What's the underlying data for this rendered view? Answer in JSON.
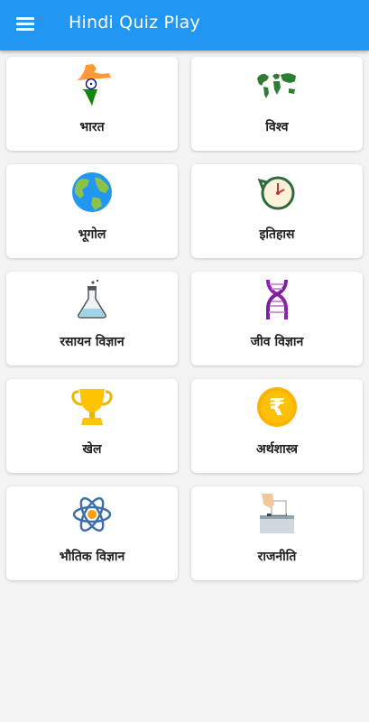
{
  "appbar": {
    "title": "Hindi Quiz Play",
    "menu_icon": "hamburger-menu-icon",
    "color": "#2196f3"
  },
  "categories": [
    {
      "label": "भारत",
      "icon": "india-map-flag-icon"
    },
    {
      "label": "विश्व",
      "icon": "world-map-icon"
    },
    {
      "label": "भूगोल",
      "icon": "globe-icon"
    },
    {
      "label": "इतिहास",
      "icon": "history-clock-icon"
    },
    {
      "label": "रसायन विज्ञान",
      "icon": "chemistry-flask-icon"
    },
    {
      "label": "जीव विज्ञान",
      "icon": "dna-icon"
    },
    {
      "label": "खेल",
      "icon": "trophy-icon"
    },
    {
      "label": "अर्थशास्त्र",
      "icon": "rupee-coin-icon"
    },
    {
      "label": "भौतिक विज्ञान",
      "icon": "atom-icon"
    },
    {
      "label": "राजनीति",
      "icon": "ballot-box-icon"
    }
  ]
}
